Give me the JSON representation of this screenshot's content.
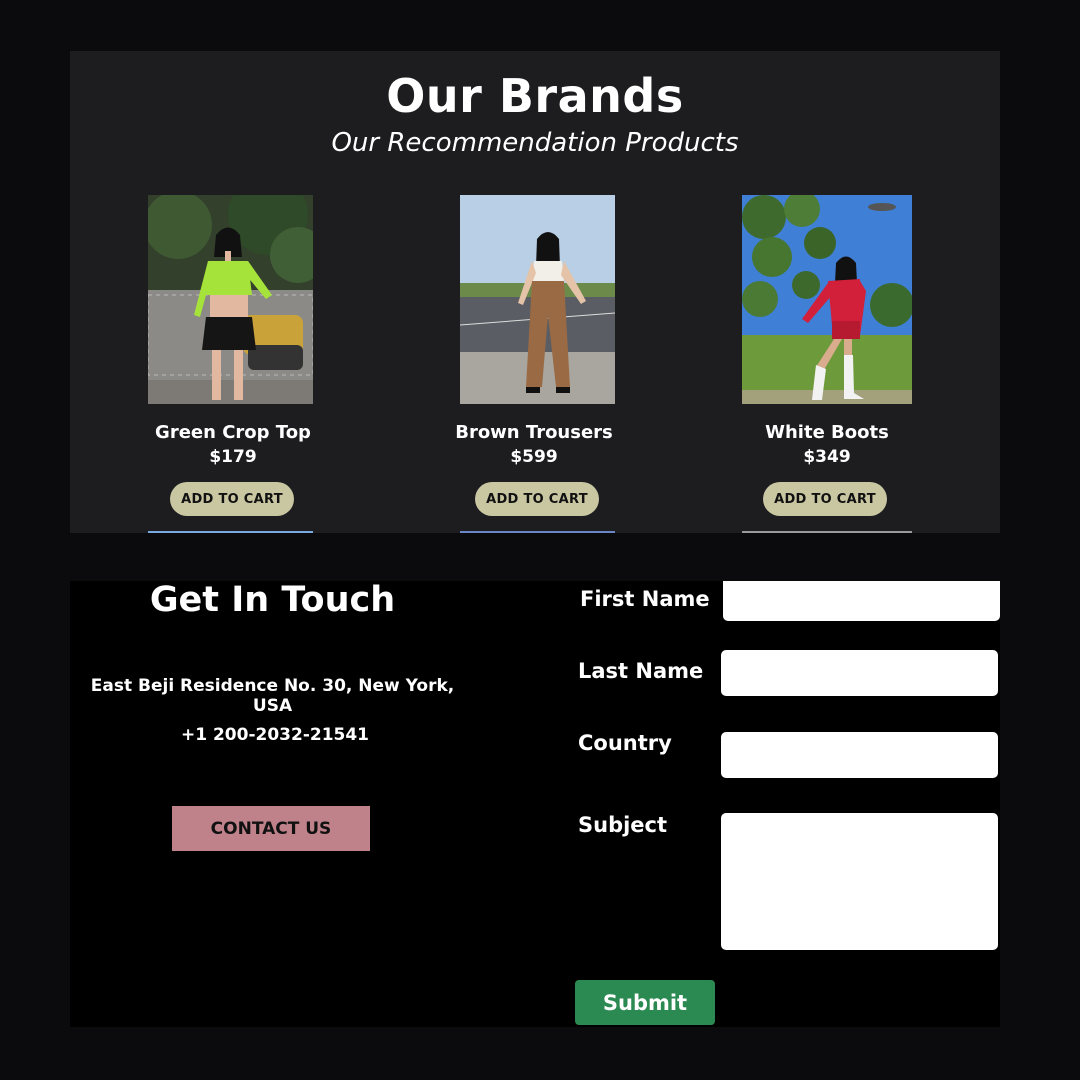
{
  "brands": {
    "title": "Our Brands",
    "subtitle": "Our Recommendation Products",
    "add_to_cart_label": "ADD TO CART",
    "products": [
      {
        "name": "Green Crop Top",
        "price": "$179"
      },
      {
        "name": "Brown Trousers",
        "price": "$599"
      },
      {
        "name": "White Boots",
        "price": "$349"
      }
    ]
  },
  "contact": {
    "title": "Get In Touch",
    "address": "East Beji Residence No. 30, New York, USA",
    "phone": "+1 200-2032-21541",
    "button": "CONTACT US"
  },
  "form": {
    "first_name_label": "First Name",
    "last_name_label": "Last Name",
    "country_label": "Country",
    "subject_label": "Subject",
    "submit": "Submit"
  },
  "colors": {
    "page_bg": "#0b0b0d",
    "brands_bg": "#1d1d1f",
    "cart_button": "#c9c6a2",
    "contact_button": "#c0828a",
    "submit_button": "#2b8a52"
  }
}
